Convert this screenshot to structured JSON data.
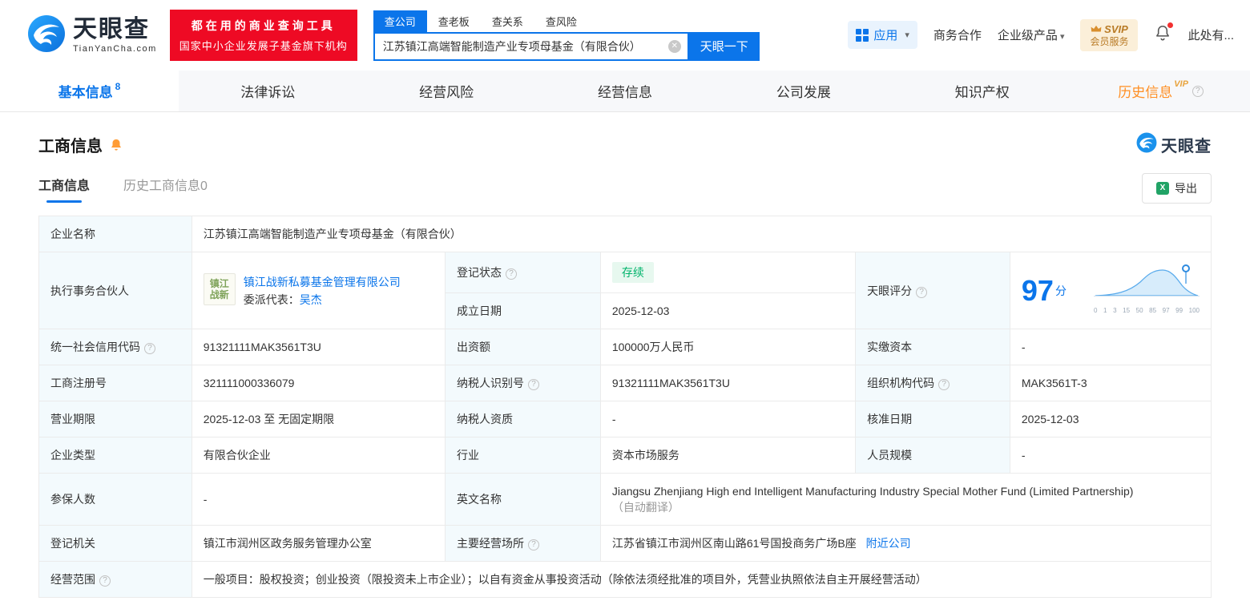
{
  "header": {
    "logo_text": "天眼查",
    "logo_domain": "TianYanCha.com",
    "promo": {
      "line1": "都在用的商业查询工具",
      "line2": "国家中小企业发展子基金旗下机构"
    },
    "search_tabs": [
      "查公司",
      "查老板",
      "查关系",
      "查风险"
    ],
    "search": {
      "value": "江苏镇江高端智能制造产业专项母基金（有限合伙）",
      "button": "天眼一下"
    },
    "apps_label": "应用",
    "links": {
      "cooperation": "商务合作",
      "enterprise": "企业级产品",
      "more": "此处有..."
    },
    "svip": {
      "line1": "SVIP",
      "line2": "会员服务"
    }
  },
  "nav_tabs": [
    {
      "label": "基本信息",
      "count": "8"
    },
    {
      "label": "法律诉讼"
    },
    {
      "label": "经营风险"
    },
    {
      "label": "经营信息"
    },
    {
      "label": "公司发展"
    },
    {
      "label": "知识产权"
    },
    {
      "label": "历史信息",
      "vip": "VIP"
    }
  ],
  "section": {
    "title": "工商信息",
    "watermark": "天眼查",
    "subtab_active": "工商信息",
    "subtab_history": "历史工商信息0",
    "export_label": "导出"
  },
  "info": {
    "company_name_label": "企业名称",
    "company_name": "江苏镇江高端智能制造产业专项母基金（有限合伙）",
    "partner_label": "执行事务合伙人",
    "partner_logo_line1": "镇江",
    "partner_logo_line2": "战新",
    "partner_company": "镇江战新私募基金管理有限公司",
    "partner_rep_label": "委派代表：",
    "partner_rep_name": "吴杰",
    "reg_status_label": "登记状态",
    "reg_status": "存续",
    "establish_date_label": "成立日期",
    "establish_date": "2025-12-03",
    "score_label": "天眼评分",
    "credit_code_label": "统一社会信用代码",
    "credit_code": "91321111MAK3561T3U",
    "capital_label": "出资额",
    "capital": "100000万人民币",
    "paid_capital_label": "实缴资本",
    "paid_capital": "-",
    "reg_number_label": "工商注册号",
    "reg_number": "321111000336079",
    "taxpayer_id_label": "纳税人识别号",
    "taxpayer_id": "91321111MAK3561T3U",
    "org_code_label": "组织机构代码",
    "org_code": "MAK3561T-3",
    "business_term_label": "营业期限",
    "business_term": "2025-12-03 至 无固定期限",
    "taxpayer_qualification_label": "纳税人资质",
    "taxpayer_qualification": "-",
    "approval_date_label": "核准日期",
    "approval_date": "2025-12-03",
    "company_type_label": "企业类型",
    "company_type": "有限合伙企业",
    "industry_label": "行业",
    "industry": "资本市场服务",
    "staff_size_label": "人员规模",
    "staff_size": "-",
    "insured_count_label": "参保人数",
    "insured_count": "-",
    "english_name_label": "英文名称",
    "english_name": "Jiangsu Zhenjiang High end Intelligent Manufacturing Industry Special Mother Fund (Limited Partnership)",
    "english_name_note": "（自动翻译）",
    "registry_label": "登记机关",
    "registry": "镇江市润州区政务服务管理办公室",
    "address_label": "主要经营场所",
    "address": "江苏省镇江市润州区南山路61号国投商务广场B座",
    "nearby_link": "附近公司",
    "scope_label": "经营范围",
    "scope": "一般项目：股权投资；创业投资（限投资未上市企业）；以自有资金从事投资活动（除依法须经批准的项目外，凭营业执照依法自主开展经营活动）"
  },
  "score": {
    "value": "97",
    "unit": "分",
    "axis": [
      "0",
      "1",
      "3",
      "15",
      "50",
      "85",
      "97",
      "99",
      "100"
    ]
  }
}
